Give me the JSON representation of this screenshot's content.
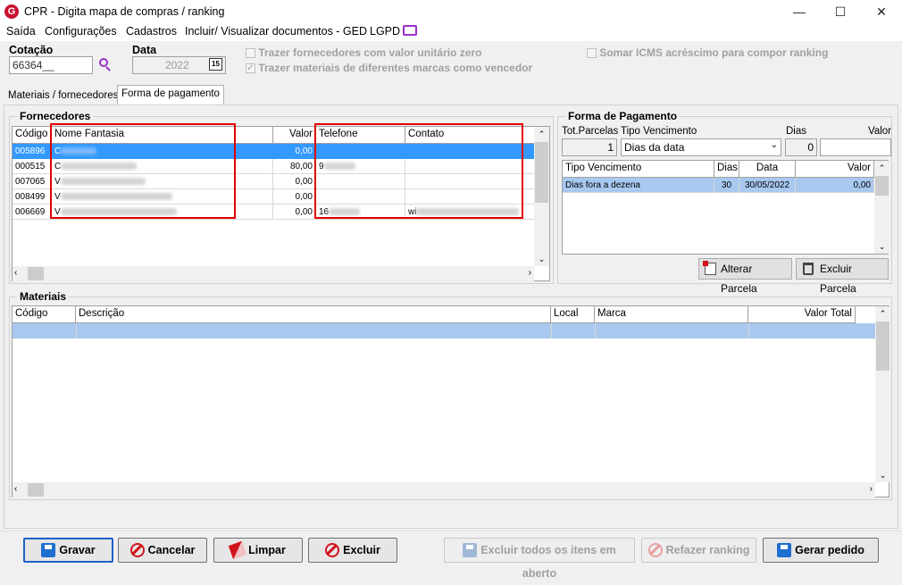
{
  "window": {
    "title": "CPR - Digita mapa de compras / ranking",
    "app_icon": "G"
  },
  "menu": [
    "Saída",
    "Configurações",
    "Cadastros",
    "Incluir/ Visualizar documentos - GED",
    "LGPD"
  ],
  "cotacao": {
    "label": "Cotação",
    "value": "66364__"
  },
  "data": {
    "label": "Data",
    "value": "2022"
  },
  "options": {
    "zero": "Trazer fornecedores com valor unitário zero",
    "marcas": "Trazer materiais de diferentes marcas como vencedor",
    "icms": "Somar ICMS acréscimo para compor ranking"
  },
  "tabs": [
    "Materiais / fornecedores",
    "Forma de pagamento"
  ],
  "fornecedores": {
    "title": "Fornecedores",
    "columns": [
      "Código",
      "Nome Fantasia",
      "Valor",
      "Telefone",
      "Contato"
    ],
    "rows": [
      {
        "codigo": "005896",
        "nome": "C",
        "valor": "0,00",
        "telefone": "",
        "contato": ""
      },
      {
        "codigo": "000515",
        "nome": "C",
        "valor": "80,00",
        "telefone": "9",
        "contato": ""
      },
      {
        "codigo": "007065",
        "nome": "V",
        "valor": "0,00",
        "telefone": "",
        "contato": ""
      },
      {
        "codigo": "008499",
        "nome": "V",
        "valor": "0,00",
        "telefone": "",
        "contato": ""
      },
      {
        "codigo": "006669",
        "nome": "V",
        "valor": "0,00",
        "telefone": "16",
        "contato": "wi"
      }
    ]
  },
  "pagamento": {
    "title": "Forma de Pagamento",
    "tot_label": "Tot.Parcelas",
    "tot_value": "1",
    "tipo_label": "Tipo Vencimento",
    "tipo_value": "Dias da data",
    "dias_label": "Dias",
    "dias_value": "0",
    "valor_label": "Valor",
    "columns": [
      "Tipo Vencimento",
      "Dias",
      "Data",
      "Valor"
    ],
    "rows": [
      {
        "tipo": "Dias fora a dezena",
        "dias": "30",
        "data": "30/05/2022",
        "valor": "0,00"
      }
    ],
    "alterar": "Alterar Parcela",
    "excluir": "Excluir Parcela"
  },
  "materiais": {
    "title": "Materiais",
    "columns": [
      "Código",
      "Descrição",
      "Local",
      "Marca",
      "Valor Total"
    ]
  },
  "buttons": {
    "gravar": "Gravar",
    "cancelar": "Cancelar",
    "limpar": "Limpar",
    "excluir": "Excluir",
    "excluir_todos": "Excluir todos os itens em aberto",
    "refazer": "Refazer ranking",
    "gerar": "Gerar pedido"
  }
}
